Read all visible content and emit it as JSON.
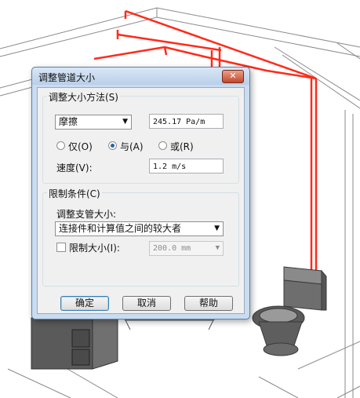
{
  "dialog": {
    "title": "调整管道大小",
    "close_icon": "close-icon",
    "method_group": {
      "label": "调整大小方法(S)",
      "method_select": {
        "value": "摩擦"
      },
      "friction_value": "245.17 Pa/m",
      "radio_only": "仅(O)",
      "radio_and": "与(A)",
      "radio_or": "或(R)",
      "radio_selected": "与(A)",
      "velocity_label": "速度(V):",
      "velocity_value": "1.2 m/s"
    },
    "constraints_group": {
      "label": "限制条件(C)",
      "branch_label": "调整支管大小:",
      "branch_select": {
        "value": "连接件和计算值之间的较大者"
      },
      "limit_checkbox_label": "限制大小(I):",
      "limit_checked": false,
      "limit_select": {
        "value": "200.0 mm"
      }
    },
    "buttons": {
      "ok": "确定",
      "cancel": "取消",
      "help": "帮助"
    }
  },
  "colors": {
    "pipe": "#ff2a1a",
    "dialog_frame": "#c9dcf0",
    "close_button": "#c2472b"
  }
}
